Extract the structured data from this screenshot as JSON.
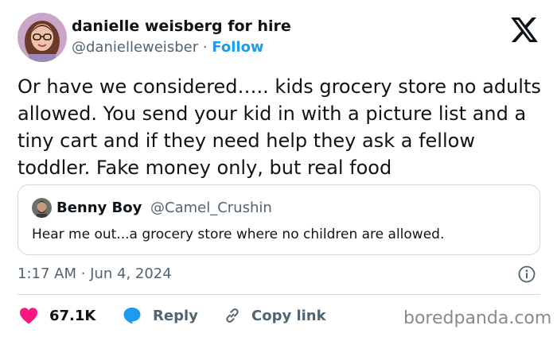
{
  "author": {
    "display_name": "danielle weisberg for hire",
    "handle": "@danielleweisber",
    "separator": "·",
    "follow_label": "Follow"
  },
  "tweet": {
    "text": "Or have we considered….. kids grocery store no adults allowed. You send your kid in with a picture list and a tiny cart and if they need help they ask a fellow toddler. Fake money only, but real food"
  },
  "quoted_tweet": {
    "display_name": "Benny Boy",
    "handle": "@Camel_Crushin",
    "text": "Hear me out...a grocery store where no children are allowed."
  },
  "timestamp": "1:17 AM · Jun 4, 2024",
  "actions": {
    "like_count": "67.1K",
    "reply_label": "Reply",
    "copy_link_label": "Copy link"
  },
  "watermark": "boredpanda.com",
  "colors": {
    "link_blue": "#1d9bf0",
    "like_red": "#f91880",
    "text_primary": "#0f1419",
    "text_secondary": "#536471",
    "border": "#cfd9de"
  },
  "icons": {
    "platform_logo": "x-logo-icon",
    "info": "info-icon",
    "like": "heart-icon",
    "reply": "speech-bubble-icon",
    "copy_link": "link-icon"
  }
}
